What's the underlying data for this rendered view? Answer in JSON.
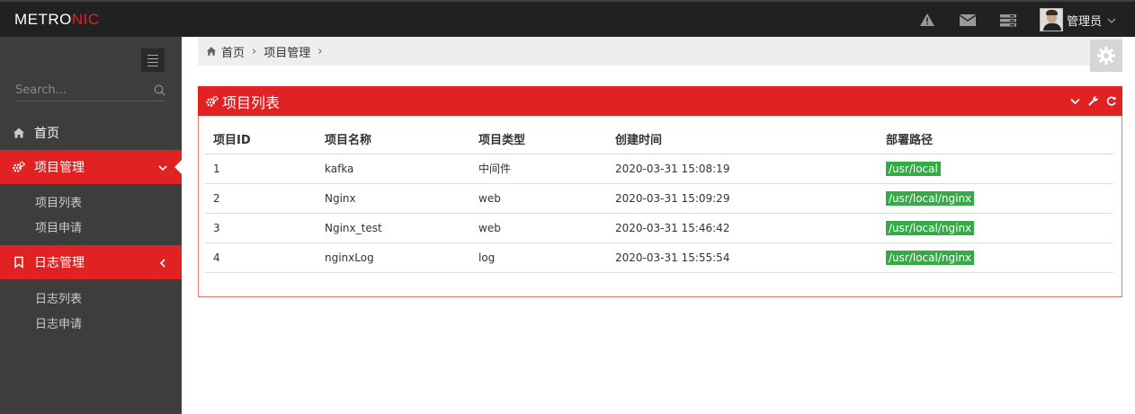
{
  "header": {
    "logo_main": "METRO",
    "logo_accent": "NIC",
    "user_name": "管理员"
  },
  "sidebar": {
    "search_placeholder": "Search...",
    "nav": [
      {
        "label": "首页"
      },
      {
        "label": "项目管理",
        "sub": [
          "项目列表",
          "项目申请"
        ]
      },
      {
        "label": "日志管理",
        "sub": [
          "日志列表",
          "日志申请"
        ]
      }
    ]
  },
  "breadcrumb": [
    "首页",
    "项目管理"
  ],
  "portlet": {
    "title": "项目列表",
    "columns": [
      "项目ID",
      "项目名称",
      "项目类型",
      "创建时间",
      "部署路径"
    ],
    "rows": [
      [
        "1",
        "kafka",
        "中间件",
        "2020-03-31 15:08:19",
        "/usr/local"
      ],
      [
        "2",
        "Nginx",
        "web",
        "2020-03-31 15:09:29",
        "/usr/local/nginx"
      ],
      [
        "3",
        "Nginx_test",
        "web",
        "2020-03-31 15:46:42",
        "/usr/local/nginx"
      ],
      [
        "4",
        "nginxLog",
        "log",
        "2020-03-31 15:55:54",
        "/usr/local/nginx"
      ]
    ]
  },
  "colors": {
    "accent": "#e02222",
    "header_bg": "#212121",
    "sidebar_bg": "#3d3d3d",
    "badge": "#35aa47"
  },
  "icons": [
    "warning-icon",
    "envelope-icon",
    "tasks-icon",
    "home-icon",
    "cogs-icon",
    "bookmark-icon",
    "gear-icon",
    "chevron-down-icon",
    "wrench-icon",
    "refresh-icon",
    "search-icon"
  ]
}
